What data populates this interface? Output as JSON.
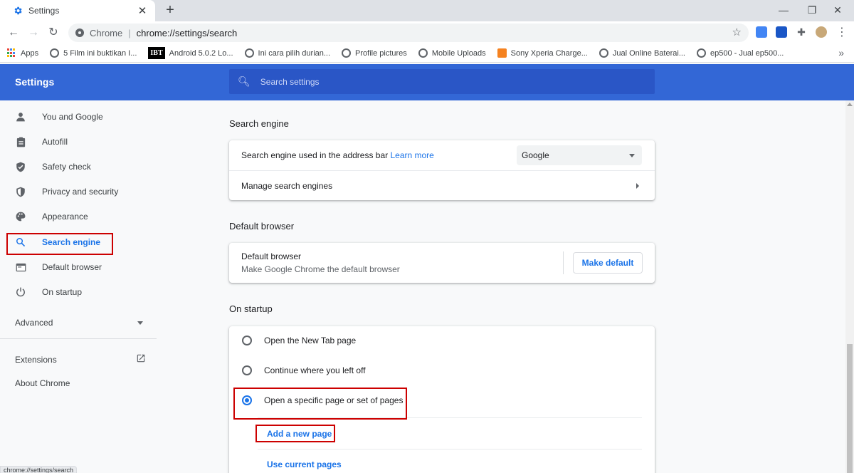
{
  "browser": {
    "tab_title": "Settings",
    "new_tab_label": "+",
    "close_tab_label": "✕",
    "omnibox_origin": "Chrome",
    "omnibox_url": "chrome://settings/search",
    "status_url": "chrome://settings/search"
  },
  "bookmarks": [
    {
      "label": "Apps",
      "icon": "apps-icon"
    },
    {
      "label": "5 Film ini buktikan I...",
      "icon": "globe-icon"
    },
    {
      "label": "Android 5.0.2 Lo...",
      "icon": "ibt-logo",
      "badge": "IBT"
    },
    {
      "label": "Ini cara pilih durian...",
      "icon": "globe-icon"
    },
    {
      "label": "Profile pictures",
      "icon": "globe-icon"
    },
    {
      "label": "Mobile Uploads",
      "icon": "globe-icon"
    },
    {
      "label": "Sony Xperia Charge...",
      "icon": "site-icon"
    },
    {
      "label": "Jual Online Baterai...",
      "icon": "globe-icon"
    },
    {
      "label": "ep500 - Jual ep500...",
      "icon": "globe-icon"
    }
  ],
  "settings": {
    "title": "Settings",
    "search_placeholder": "Search settings"
  },
  "sidebar": {
    "items": [
      {
        "label": "You and Google",
        "icon": "person-icon"
      },
      {
        "label": "Autofill",
        "icon": "clipboard-icon"
      },
      {
        "label": "Safety check",
        "icon": "shield-check-icon"
      },
      {
        "label": "Privacy and security",
        "icon": "shield-icon"
      },
      {
        "label": "Appearance",
        "icon": "palette-icon"
      },
      {
        "label": "Search engine",
        "icon": "search-icon",
        "active": true
      },
      {
        "label": "Default browser",
        "icon": "browser-icon"
      },
      {
        "label": "On startup",
        "icon": "power-icon"
      }
    ],
    "advanced_label": "Advanced",
    "extensions_label": "Extensions",
    "about_label": "About Chrome"
  },
  "search_engine": {
    "section_title": "Search engine",
    "used_label": "Search engine used in the address bar",
    "learn_more": "Learn more",
    "selected_engine": "Google",
    "manage_label": "Manage search engines"
  },
  "default_browser": {
    "section_title": "Default browser",
    "row_title": "Default browser",
    "row_subtitle": "Make Google Chrome the default browser",
    "button_label": "Make default"
  },
  "on_startup": {
    "section_title": "On startup",
    "options": [
      {
        "label": "Open the New Tab page",
        "checked": false
      },
      {
        "label": "Continue where you left off",
        "checked": false
      },
      {
        "label": "Open a specific page or set of pages",
        "checked": true
      }
    ],
    "add_page": "Add a new page",
    "use_current": "Use current pages"
  },
  "colors": {
    "header_blue": "#3367d6",
    "accent": "#1a73e8",
    "highlight_red": "#cc0000"
  }
}
